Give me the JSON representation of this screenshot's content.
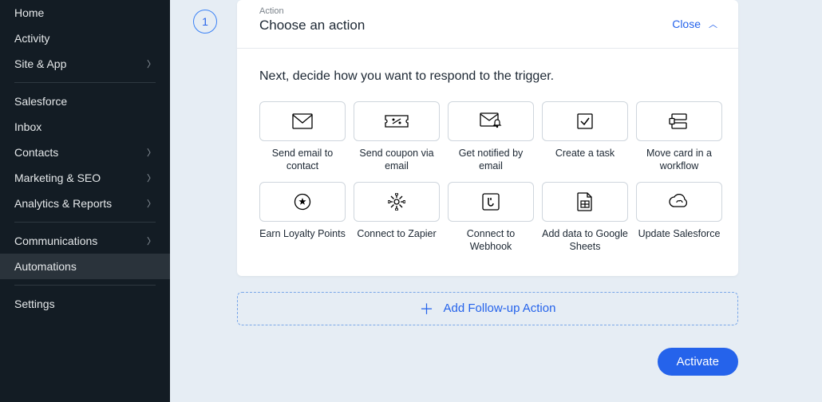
{
  "sidebar": {
    "items": [
      {
        "label": "Home",
        "chevron": false
      },
      {
        "label": "Activity",
        "chevron": false
      },
      {
        "label": "Site & App",
        "chevron": true
      }
    ],
    "items2": [
      {
        "label": "Salesforce",
        "chevron": false
      },
      {
        "label": "Inbox",
        "chevron": false
      },
      {
        "label": "Contacts",
        "chevron": true
      },
      {
        "label": "Marketing & SEO",
        "chevron": true
      },
      {
        "label": "Analytics & Reports",
        "chevron": true
      }
    ],
    "items3": [
      {
        "label": "Communications",
        "chevron": true
      },
      {
        "label": "Automations",
        "chevron": false,
        "active": true
      }
    ],
    "items4": [
      {
        "label": "Settings",
        "chevron": false
      }
    ]
  },
  "panel": {
    "step": "1",
    "label": "Action",
    "title": "Choose an action",
    "close": "Close",
    "prompt": "Next, decide how you want to respond to the trigger.",
    "follow_label": "Add Follow-up Action",
    "activate": "Activate"
  },
  "actions": [
    {
      "label": "Send email to contact",
      "icon": "mail-icon"
    },
    {
      "label": "Send coupon via email",
      "icon": "coupon-icon"
    },
    {
      "label": "Get notified by email",
      "icon": "notify-icon"
    },
    {
      "label": "Create a task",
      "icon": "task-icon"
    },
    {
      "label": "Move card in a workflow",
      "icon": "workflow-icon"
    },
    {
      "label": "Earn Loyalty Points",
      "icon": "star-icon"
    },
    {
      "label": "Connect to Zapier",
      "icon": "zapier-icon"
    },
    {
      "label": "Connect to Webhook",
      "icon": "webhook-icon"
    },
    {
      "label": "Add data to Google Sheets",
      "icon": "sheets-icon"
    },
    {
      "label": "Update Salesforce",
      "icon": "cloud-icon"
    }
  ]
}
